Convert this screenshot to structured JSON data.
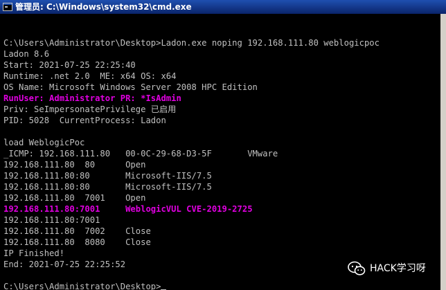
{
  "window": {
    "title": "管理员: C:\\Windows\\system32\\cmd.exe",
    "icon": "cmd-prompt-icon"
  },
  "console": {
    "lines": [
      {
        "text": "",
        "highlight": false
      },
      {
        "text": "",
        "highlight": false
      },
      {
        "text": "C:\\Users\\Administrator\\Desktop>Ladon.exe noping 192.168.111.80 weblogicpoc",
        "highlight": false
      },
      {
        "text": "Ladon 8.6",
        "highlight": false
      },
      {
        "text": "Start: 2021-07-25 22:25:40",
        "highlight": false
      },
      {
        "text": "Runtime: .net 2.0  ME: x64 OS: x64",
        "highlight": false
      },
      {
        "text": "OS Name: Microsoft Windows Server 2008 HPC Edition",
        "highlight": false
      },
      {
        "text": "RunUser: Administrator PR: *IsAdmin",
        "highlight": true
      },
      {
        "text": "Priv: SeImpersonatePrivilege 已启用",
        "highlight": false
      },
      {
        "text": "PID: 5028  CurrentProcess: Ladon",
        "highlight": false
      },
      {
        "text": "",
        "highlight": false
      },
      {
        "text": "load WeblogicPoc",
        "highlight": false
      },
      {
        "text": "_ICMP: 192.168.111.80   00-0C-29-68-D3-5F       VMware",
        "highlight": false
      },
      {
        "text": "192.168.111.80  80      Open",
        "highlight": false
      },
      {
        "text": "192.168.111.80:80       Microsoft-IIS/7.5",
        "highlight": false
      },
      {
        "text": "192.168.111.80:80       Microsoft-IIS/7.5",
        "highlight": false
      },
      {
        "text": "192.168.111.80  7001    Open",
        "highlight": false
      },
      {
        "text": "192.168.111.80:7001     WeblogicVUL CVE-2019-2725",
        "highlight": true
      },
      {
        "text": "192.168.111.80:7001",
        "highlight": false
      },
      {
        "text": "192.168.111.80  7002    Close",
        "highlight": false
      },
      {
        "text": "192.168.111.80  8080    Close",
        "highlight": false
      },
      {
        "text": "IP Finished!",
        "highlight": false
      },
      {
        "text": "End: 2021-07-25 22:25:52",
        "highlight": false
      },
      {
        "text": "",
        "highlight": false
      },
      {
        "text": "C:\\Users\\Administrator\\Desktop>",
        "highlight": false
      }
    ],
    "text_color": "#c0c0c0",
    "highlight_color": "#e000e0",
    "background": "#000000"
  },
  "watermark": {
    "text": "HACK学习呀",
    "icon": "wechat-icon"
  }
}
